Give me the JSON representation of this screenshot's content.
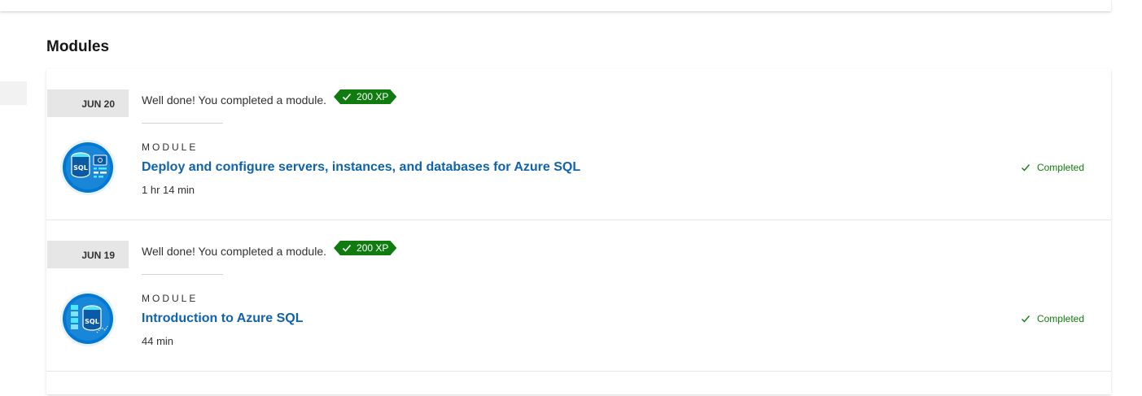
{
  "page": {
    "section_title": "Modules"
  },
  "colors": {
    "accent_link": "#0f62ac",
    "success_green": "#107c10",
    "date_badge_bg": "#e6e6e6",
    "icon_blue": "#0078d4"
  },
  "entries": [
    {
      "date": "JUN 20",
      "achievement_text": "Well done! You completed a module.",
      "xp": "200 XP",
      "xp_icon": "check-icon",
      "type_label": "MODULE",
      "title": "Deploy and configure servers, instances, and databases for Azure SQL",
      "duration": "1 hr 14 min",
      "status": "Completed",
      "status_icon": "check-icon",
      "icon": "sql-server-config-icon",
      "icon_text": "SQL"
    },
    {
      "date": "JUN 19",
      "achievement_text": "Well done! You completed a module.",
      "xp": "200 XP",
      "xp_icon": "check-icon",
      "type_label": "MODULE",
      "title": "Introduction to Azure SQL",
      "duration": "44 min",
      "status": "Completed",
      "status_icon": "check-icon",
      "icon": "sql-database-icon",
      "icon_text": "SQL"
    }
  ]
}
